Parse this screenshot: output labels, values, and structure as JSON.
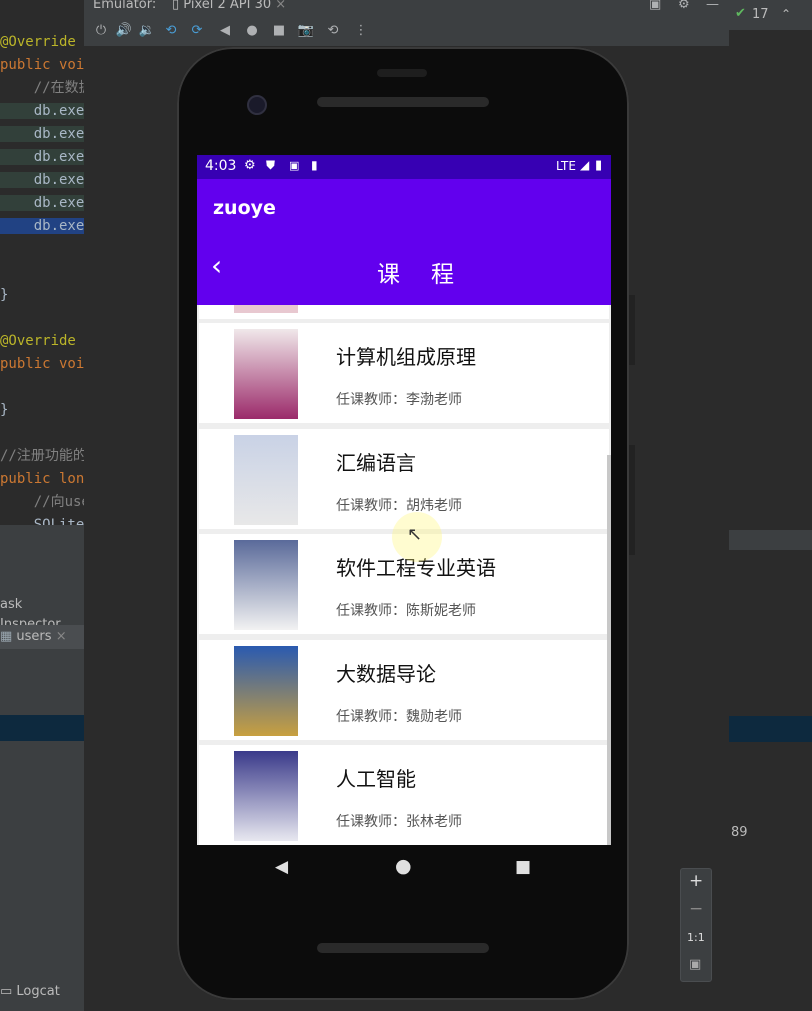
{
  "ide": {
    "tab_title": "Emulator:",
    "device_tab": "Pixel 2 API 30",
    "check_count": "17",
    "line_number": "89",
    "code_lines": [
      {
        "text": "@Override",
        "cls": "ann"
      },
      {
        "text": "public void",
        "cls": "kw"
      },
      {
        "text": "    //在数据",
        "cls": "cm"
      },
      {
        "text": "    db.exec",
        "cls": "dbl"
      },
      {
        "text": "    db.exec",
        "cls": "dbl"
      },
      {
        "text": "    db.exec",
        "cls": "dbl"
      },
      {
        "text": "    db.exec",
        "cls": "dbl"
      },
      {
        "text": "    db.exec",
        "cls": "dbl"
      },
      {
        "text": "    db.exec",
        "cls": "hl"
      },
      {
        "text": "",
        "cls": ""
      },
      {
        "text": "",
        "cls": ""
      },
      {
        "text": "}",
        "cls": ""
      },
      {
        "text": "",
        "cls": ""
      },
      {
        "text": "@Override",
        "cls": "ann"
      },
      {
        "text": "public void",
        "cls": "kw"
      },
      {
        "text": "",
        "cls": ""
      },
      {
        "text": "}",
        "cls": ""
      },
      {
        "text": "",
        "cls": ""
      },
      {
        "text": "//注册功能的",
        "cls": "cm"
      },
      {
        "text": "public long",
        "cls": "kw"
      },
      {
        "text": "    //向use",
        "cls": "cm"
      },
      {
        "text": "    SQLite",
        "cls": ""
      }
    ],
    "task_inspector": "ask Inspector",
    "users_tab": "users",
    "logcat": "Logcat"
  },
  "phone": {
    "status": {
      "time": "4:03",
      "network": "LTE"
    },
    "app_name": "zuoye",
    "page_title": "课　程",
    "courses": [
      {
        "name": "计算机组成原理",
        "teacher": "任课教师：李渤老师",
        "cover_top": "#f0e8ea",
        "cover_bottom": "#9b2a6a"
      },
      {
        "name": "汇编语言",
        "teacher": "任课教师：胡炜老师",
        "cover_top": "#c9d2e6",
        "cover_bottom": "#e8e8e8"
      },
      {
        "name": "软件工程专业英语",
        "teacher": "任课教师：陈斯妮老师",
        "cover_top": "#5a6a9a",
        "cover_bottom": "#f2f2f2"
      },
      {
        "name": "大数据导论",
        "teacher": "任课教师：魏勋老师",
        "cover_top": "#2a5ab0",
        "cover_bottom": "#c8a040"
      },
      {
        "name": "人工智能",
        "teacher": "任课教师：张林老师",
        "cover_top": "#3a3a8a",
        "cover_bottom": "#e8e8f0"
      }
    ]
  },
  "zoom": {
    "plus": "+",
    "minus": "−",
    "ratio": "1:1"
  },
  "colors": {
    "status_bar": "#3700b3",
    "app_bar": "#6200ee"
  }
}
